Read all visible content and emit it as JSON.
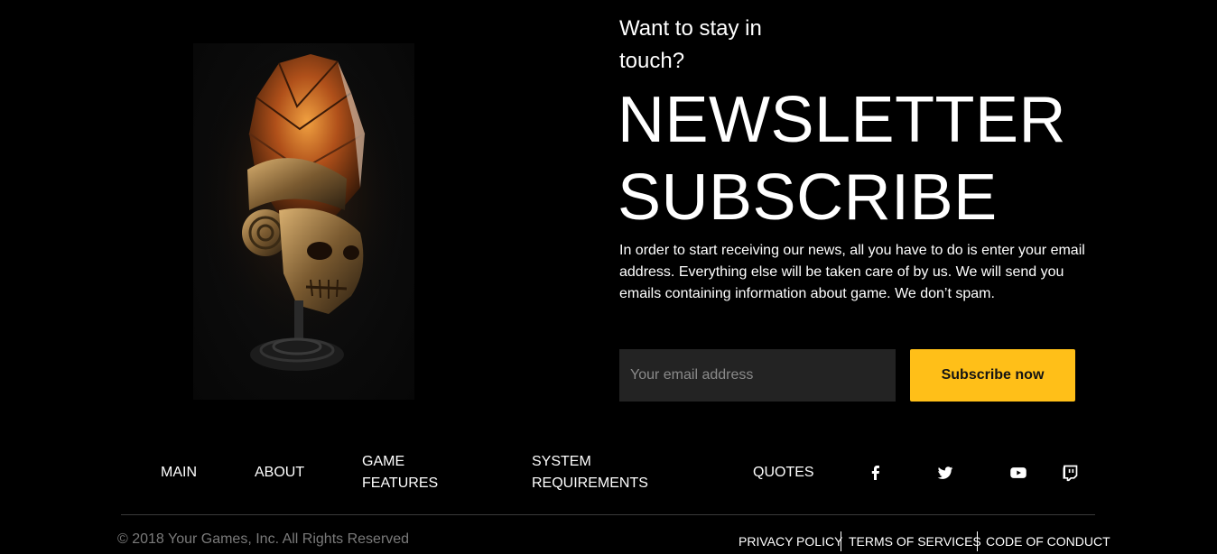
{
  "hero": {
    "eyebrow_line1": "Want to stay in",
    "eyebrow_line2": "touch?",
    "headline_line1": "NEWSLETTER",
    "headline_line2": "SUBSCRIBE",
    "description": "In order to start receiving our news, all you have to do is enter your email address. Everything else will be taken care of by us. We will send you emails containing information about game. We don’t spam.",
    "email_placeholder": "Your email address",
    "email_value": "",
    "subscribe_label": "Subscribe now",
    "accent_color": "#ffbf18",
    "artwork_icon": "skull-helmet-artwork"
  },
  "nav": {
    "items": [
      {
        "line1": "MAIN",
        "line2": ""
      },
      {
        "line1": "ABOUT",
        "line2": ""
      },
      {
        "line1": "GAME",
        "line2": "FEATURES"
      },
      {
        "line1": "SYSTEM",
        "line2": "REQUIREMENTS"
      },
      {
        "line1": "QUOTES",
        "line2": ""
      }
    ],
    "social": [
      "facebook-icon",
      "twitter-icon",
      "youtube-icon",
      "twitch-icon"
    ]
  },
  "footer": {
    "copyright": "© 2018 Your Games, Inc. All Rights Reserved",
    "links": [
      "PRIVACY POLICY",
      "TERMS OF SERVICES",
      "CODE OF CONDUCT"
    ]
  }
}
